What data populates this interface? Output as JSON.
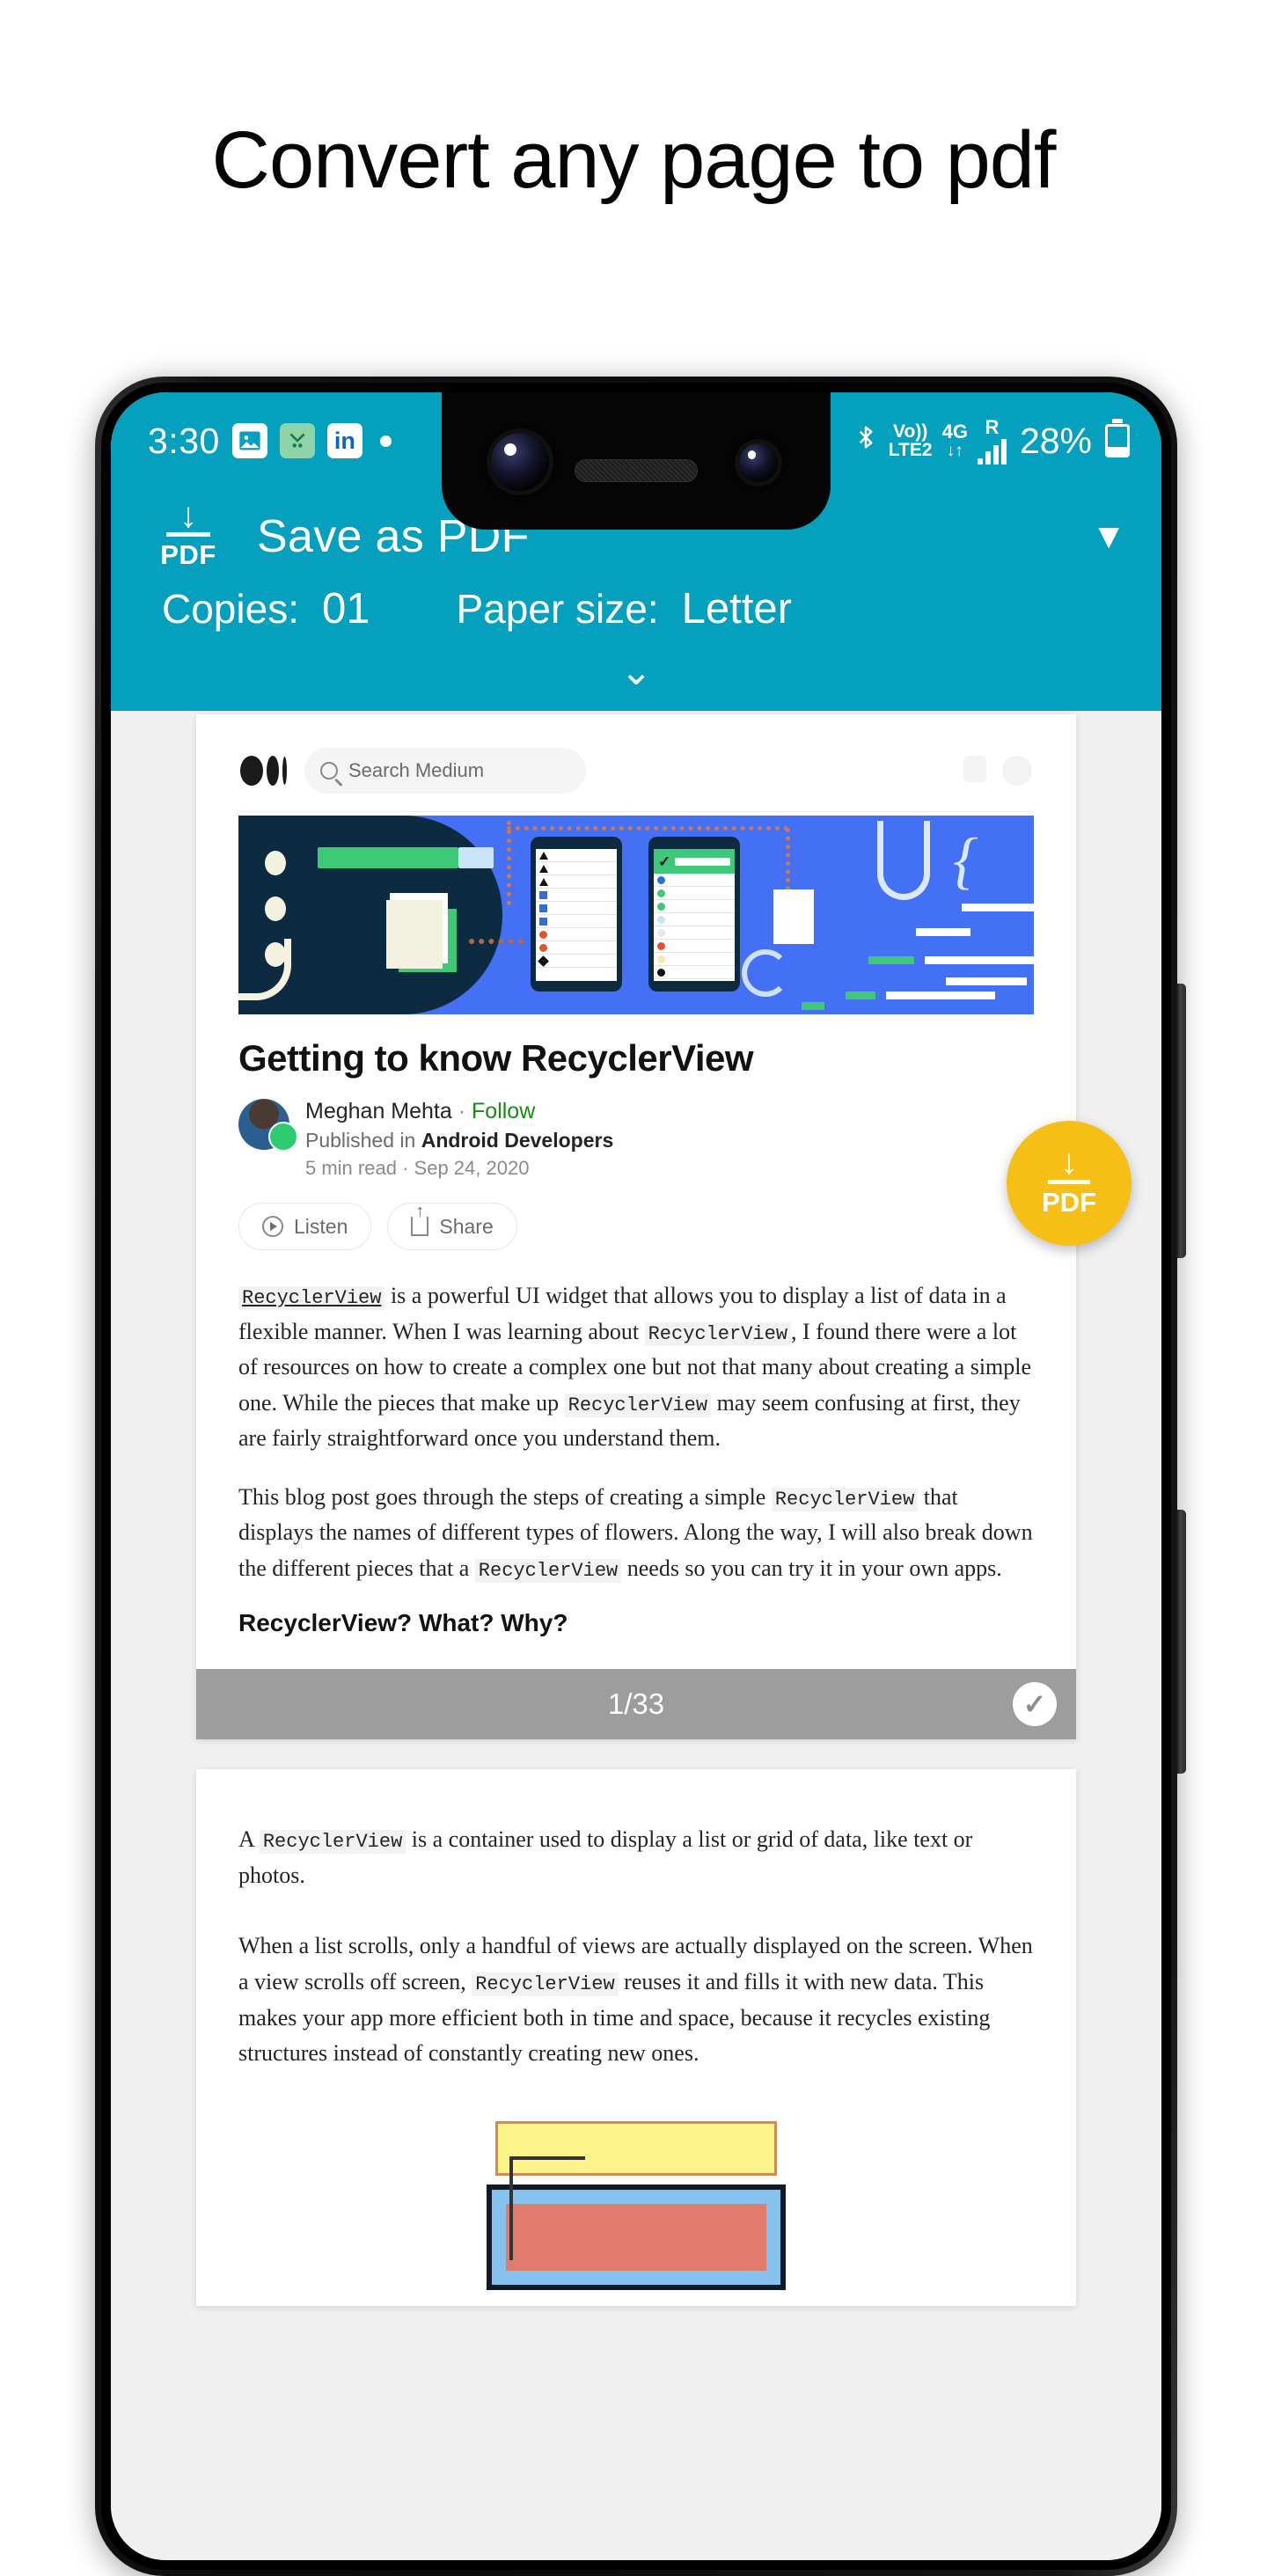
{
  "promo": {
    "headline": "Convert any page to pdf"
  },
  "statusbar": {
    "clock": "3:30",
    "icons": [
      "photos-icon",
      "green-app-icon",
      "linkedin-icon",
      "dot-indicator"
    ],
    "linkedin_label": "in",
    "bluetooth": "bluetooth-icon",
    "volte_top": "Vo))",
    "volte_bottom": "LTE2",
    "network": "4G",
    "data_arrows": "↓↑",
    "roaming": "R",
    "battery_percent": "28%"
  },
  "header": {
    "pdf_icon_label": "PDF",
    "title": "Save as PDF",
    "dropdown_icon": "▼",
    "copies_label": "Copies:",
    "copies_value": "01",
    "paper_size_label": "Paper size:",
    "paper_size_value": "Letter",
    "expand_icon": "⌄",
    "accent_color": "#05a0bd"
  },
  "fab": {
    "label": "PDF",
    "color": "#f6bf16"
  },
  "preview": {
    "medium": {
      "search_placeholder": "Search Medium"
    },
    "article": {
      "title": "Getting to know RecyclerView",
      "author": "Meghan Mehta",
      "separator": "·",
      "follow": "Follow",
      "published_prefix": "Published in ",
      "publication": "Android Developers",
      "read_time": "5 min read",
      "date": "Sep 24, 2020",
      "listen_label": "Listen",
      "share_label": "Share",
      "p1_a": " is a powerful UI widget that allows you to display a list of data in a flexible manner. When I was learning about ",
      "p1_b": ", I found there were a lot of resources on how to create a complex one but not that many about creating a simple one. While the pieces that make up ",
      "p1_c": " may seem confusing at first, they are fairly straightforward once you understand them.",
      "p2_a": "This blog post goes through the steps of creating a simple ",
      "p2_b": " that displays the names of different types of flowers. Along the way, I will also break down the different pieces that a ",
      "p2_c": " needs so you can try it in your own apps.",
      "h2": "RecyclerView? What? Why?",
      "code_token": "RecyclerView"
    },
    "page1_footer": {
      "counter": "1/33",
      "check": "✓"
    },
    "page2": {
      "p1_a": "A ",
      "p1_b": " is a container used to display a list or grid of data, like text or photos.",
      "p2_a": "When a list scrolls, only a handful of views are actually displayed on the screen. When a view scrolls off screen, ",
      "p2_b": " reuses it and fills it with new data. This makes your app more efficient both in time and space, because it recycles existing structures instead of constantly creating new ones."
    }
  }
}
